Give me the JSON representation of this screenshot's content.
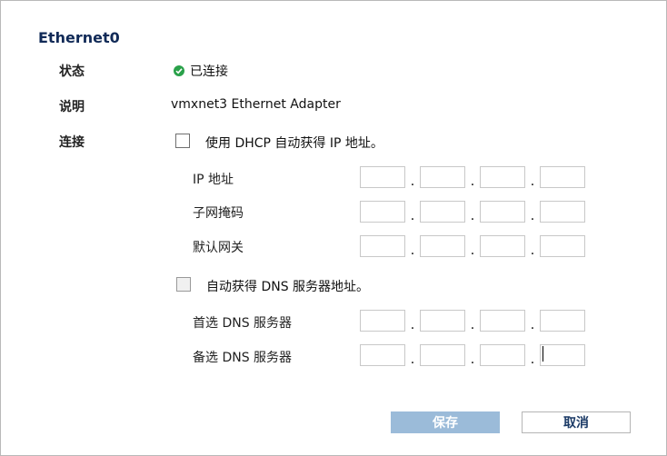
{
  "dialog": {
    "title": "Ethernet0",
    "fields": {
      "status_label": "状态",
      "status_value": "已连接",
      "status_icon": "check-circle-icon",
      "status_color": "#2aa14a",
      "description_label": "说明",
      "description_value": "vmxnet3 Ethernet Adapter",
      "connection_label": "连接"
    },
    "dhcp": {
      "label": "使用 DHCP 自动获得 IP 地址。",
      "checked": false
    },
    "ip_rows": [
      {
        "label": "IP 地址",
        "octets": [
          "",
          "",
          "",
          ""
        ]
      },
      {
        "label": "子网掩码",
        "octets": [
          "",
          "",
          "",
          ""
        ]
      },
      {
        "label": "默认网关",
        "octets": [
          "",
          "",
          "",
          ""
        ]
      }
    ],
    "dns_auto": {
      "label": "自动获得 DNS 服务器地址。",
      "checked": false
    },
    "dns_rows": [
      {
        "label": "首选 DNS 服务器",
        "octets": [
          "",
          "",
          "",
          ""
        ]
      },
      {
        "label": "备选 DNS 服务器",
        "octets": [
          "",
          "",
          "",
          ""
        ]
      }
    ],
    "ip_separator": ".",
    "buttons": {
      "save": "保存",
      "cancel": "取消"
    }
  }
}
